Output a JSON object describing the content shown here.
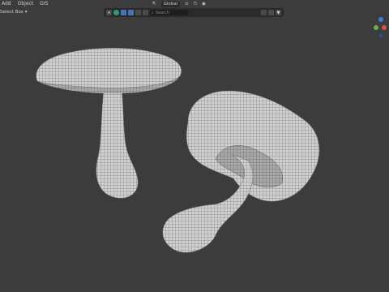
{
  "menu": {
    "add": "Add",
    "object": "Object",
    "gis": "GIS"
  },
  "select_box": "Select Box ▾",
  "header": {
    "global": "Global"
  },
  "toolbar": {
    "search_placeholder": "Search"
  },
  "gizmo": {
    "x_color": "#e64b4b",
    "y_color": "#6ab04c",
    "z_color": "#3a7ed8"
  },
  "colors": {
    "background": "#3c3c3c",
    "accent": "#4772b3"
  }
}
